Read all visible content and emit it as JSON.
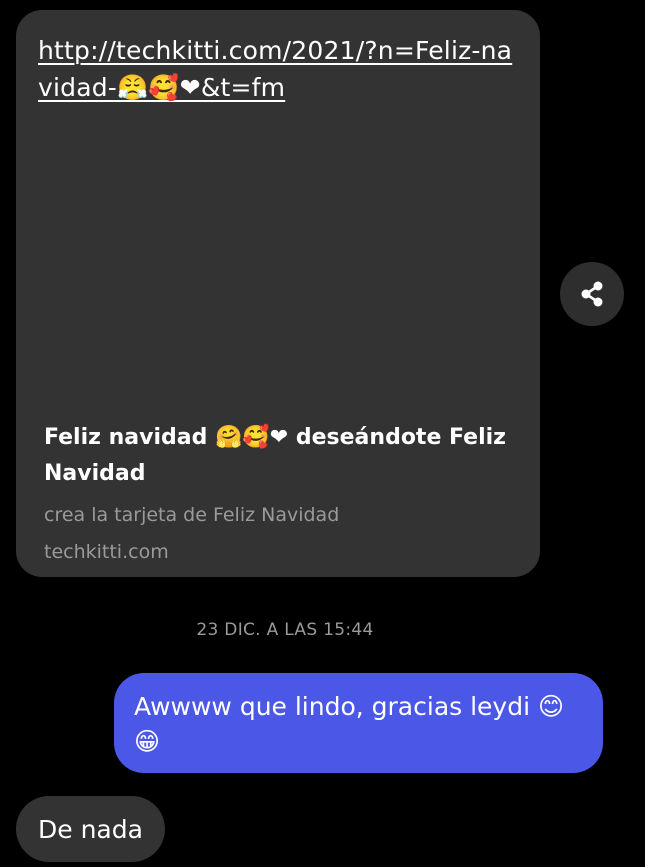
{
  "shared_link": {
    "url_text": "http://techkitti.com/2021/?n=Feliz-navidad-😤🥰❤&t=fm",
    "title": "Feliz navidad 🤗🥰❤ deseándote Feliz Navidad",
    "description": "crea la tarjeta de Feliz Navidad",
    "domain": "techkitti.com"
  },
  "share_button": {
    "icon": "share-icon"
  },
  "timestamp": "23 DIC. A LAS 15:44",
  "messages": [
    {
      "direction": "sent",
      "text": "Awwww que lindo, gracias leydi 😊😁"
    },
    {
      "direction": "received",
      "text": "De nada"
    }
  ],
  "colors": {
    "background": "#000000",
    "received_bubble": "#333333",
    "sent_bubble": "#4b57e6",
    "muted_text": "#9a9a9a"
  }
}
